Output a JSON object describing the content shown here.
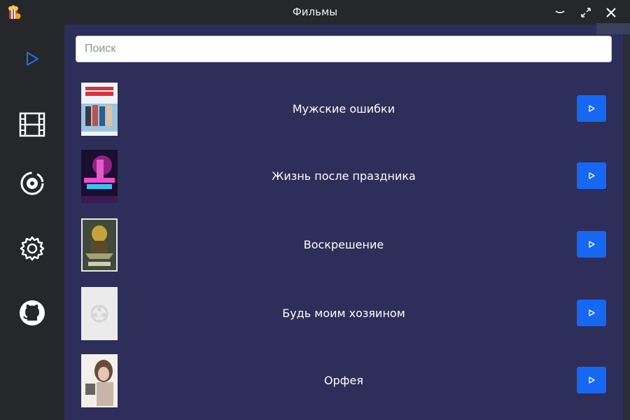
{
  "window": {
    "title": "Фильмы"
  },
  "sidebar": {
    "items": [
      {
        "icon": "play-outline-icon",
        "active": true
      },
      {
        "icon": "film-strip-icon",
        "active": false
      },
      {
        "icon": "disc-icon",
        "active": false
      },
      {
        "icon": "gear-icon",
        "active": false
      },
      {
        "icon": "github-icon",
        "active": false
      }
    ]
  },
  "search": {
    "placeholder": "Поиск",
    "value": ""
  },
  "movies": [
    {
      "title": "Мужские ошибки"
    },
    {
      "title": "Жизнь после праздника"
    },
    {
      "title": "Воскрешение"
    },
    {
      "title": "Будь моим хозяином"
    },
    {
      "title": "Орфея"
    }
  ],
  "colors": {
    "accent": "#1668f2",
    "sidebar_bg": "#26272b",
    "main_bg": "#2e2e5a",
    "active_icon": "#1f6ef5"
  }
}
